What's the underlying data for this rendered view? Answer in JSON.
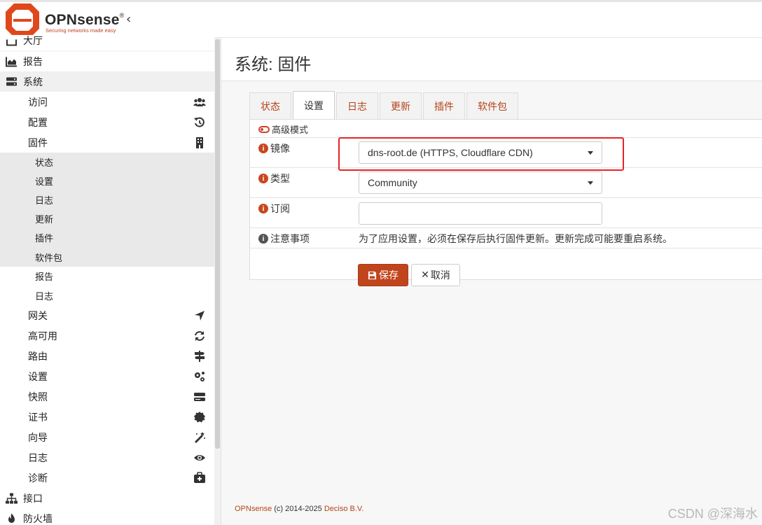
{
  "header": {
    "logo_name": "OPNsense",
    "logo_reg": "®",
    "slogan": "Securing networks made easy",
    "collapse_icon": "‹"
  },
  "sidebar": {
    "top_partial": "大厅",
    "reporting": "报告",
    "system": "系统",
    "system_items": {
      "access": "访问",
      "config": "配置",
      "firmware": "固件"
    },
    "firmware_items": [
      "状态",
      "设置",
      "日志",
      "更新",
      "插件",
      "软件包"
    ],
    "third_items": [
      "报告",
      "日志"
    ],
    "more_items": [
      "网关",
      "高可用",
      "路由",
      "设置",
      "快照",
      "证书",
      "向导",
      "日志",
      "诊断"
    ],
    "interfaces": "接口",
    "firewall": "防火墙"
  },
  "page": {
    "title": "系统: 固件"
  },
  "tabs": [
    "状态",
    "设置",
    "日志",
    "更新",
    "插件",
    "软件包"
  ],
  "active_tab": "设置",
  "form": {
    "advanced_mode": "高级模式",
    "mirror_label": "镜像",
    "mirror_value": "dns-root.de (HTTPS, Cloudflare CDN)",
    "flavour_label": "类型",
    "flavour_value": "Community",
    "subscription_label": "订阅",
    "subscription_value": "",
    "note_label": "注意事项",
    "note_text": "为了应用设置，必须在保存后执行固件更新。更新完成可能要重启系统。",
    "save": "保存",
    "cancel": "取消"
  },
  "footer": {
    "brand": "OPNsense",
    "copyright": " (c) 2014-2025 ",
    "company": "Deciso B.V."
  },
  "watermark": "CSDN @深海水",
  "colors": {
    "accent": "#c0451d",
    "highlight": "#e82323"
  }
}
